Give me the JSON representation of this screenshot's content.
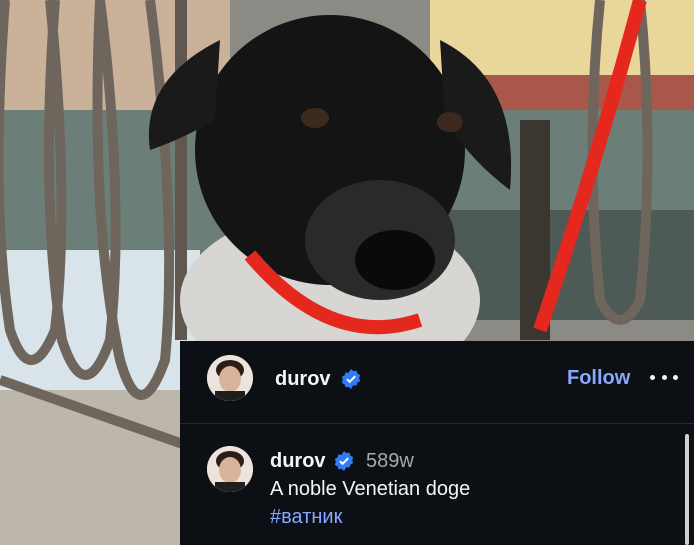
{
  "post": {
    "image_subject": "black dog in fleece coat with red collar and leash",
    "header": {
      "username": "durov",
      "follow_label": "Follow",
      "more_icon": "more-horizontal-icon"
    },
    "comment": {
      "username": "durov",
      "time_ago": "589w",
      "caption": "A noble Venetian doge",
      "hashtag": "#ватник"
    },
    "colors": {
      "panel_bg": "#0c0f14",
      "accent": "#8aa7ff",
      "verified_badge": "#2f7cf6",
      "leash": "#e4281e"
    }
  }
}
